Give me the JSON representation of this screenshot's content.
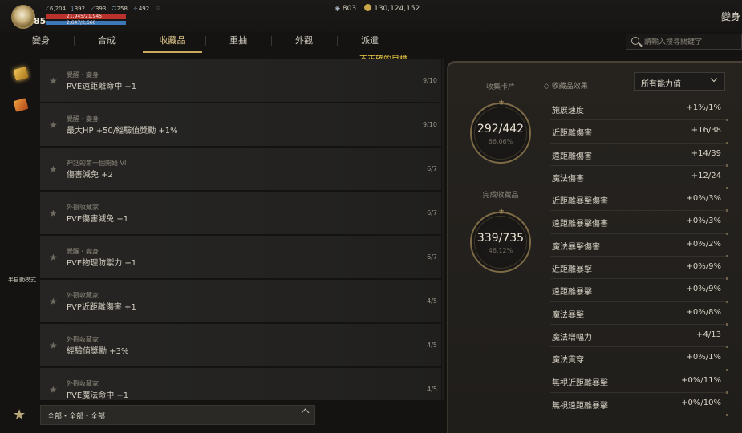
{
  "player": {
    "level": "85",
    "stats": [
      {
        "icon": "sword-icon",
        "value": "6,204"
      },
      {
        "icon": "bow-icon",
        "value": "392"
      },
      {
        "icon": "staff-icon",
        "value": "393"
      },
      {
        "icon": "shield-icon",
        "value": "258"
      },
      {
        "icon": "wings-icon",
        "value": "492"
      }
    ],
    "hp": "21,945/21,945",
    "hp_fraction": 1.0,
    "mp": "2,647/2,660",
    "mp_fraction": 0.995
  },
  "currency": {
    "gems": "803",
    "gold": "130,124,152"
  },
  "page_title": "變身",
  "tabs": [
    "變身",
    "合成",
    "收藏品",
    "重抽",
    "外觀",
    "派遣"
  ],
  "active_tab": 2,
  "search": {
    "placeholder": "請輸入搜尋關鍵字."
  },
  "warning": "不正確的目標.",
  "left_rail": {
    "semi_auto": "半自動模式"
  },
  "collections": [
    {
      "category": "覺醒・變身",
      "name": "PVE遠距離命中 +1",
      "progress": "9/10"
    },
    {
      "category": "覺醒・變身",
      "name": "最大HP +50/經驗值獎勵 +1%",
      "progress": "9/10"
    },
    {
      "category": "神話的第一個開始 VI",
      "name": "傷害減免 +2",
      "progress": "6/7"
    },
    {
      "category": "外觀收藏家",
      "name": "PVE傷害減免 +1",
      "progress": "6/7"
    },
    {
      "category": "覺醒・變身",
      "name": "PVE物理防禦力 +1",
      "progress": "6/7"
    },
    {
      "category": "外觀收藏家",
      "name": "PVP近距離傷害 +1",
      "progress": "4/5"
    },
    {
      "category": "外觀收藏家",
      "name": "經驗值獎勵 +3%",
      "progress": "4/5"
    },
    {
      "category": "外觀收藏家",
      "name": "PVE魔法命中 +1",
      "progress": "4/5"
    }
  ],
  "filter": {
    "label": "全部・全部・全部"
  },
  "summary": {
    "cards_label": "收集卡片",
    "cards_value": "292/442",
    "cards_pct": "66.06%",
    "complete_label": "完成收藏品",
    "complete_value": "339/735",
    "complete_pct": "46.12%"
  },
  "effects_title": "收藏品效果",
  "effects_filter": "所有能力值",
  "effects": [
    {
      "name": "施展速度",
      "value": "+1%/1%"
    },
    {
      "name": "近距離傷害",
      "value": "+16/38"
    },
    {
      "name": "遠距離傷害",
      "value": "+14/39"
    },
    {
      "name": "魔法傷害",
      "value": "+12/24"
    },
    {
      "name": "近距離暴擊傷害",
      "value": "+0%/3%"
    },
    {
      "name": "遠距離暴擊傷害",
      "value": "+0%/3%"
    },
    {
      "name": "魔法暴擊傷害",
      "value": "+0%/2%"
    },
    {
      "name": "近距離暴擊",
      "value": "+0%/9%"
    },
    {
      "name": "遠距離暴擊",
      "value": "+0%/9%"
    },
    {
      "name": "魔法暴擊",
      "value": "+0%/8%"
    },
    {
      "name": "魔法增幅力",
      "value": "+4/13"
    },
    {
      "name": "魔法貫穿",
      "value": "+0%/1%"
    },
    {
      "name": "無視近距離暴擊",
      "value": "+0%/11%"
    },
    {
      "name": "無視遠距離暴擊",
      "value": "+0%/10%"
    }
  ]
}
